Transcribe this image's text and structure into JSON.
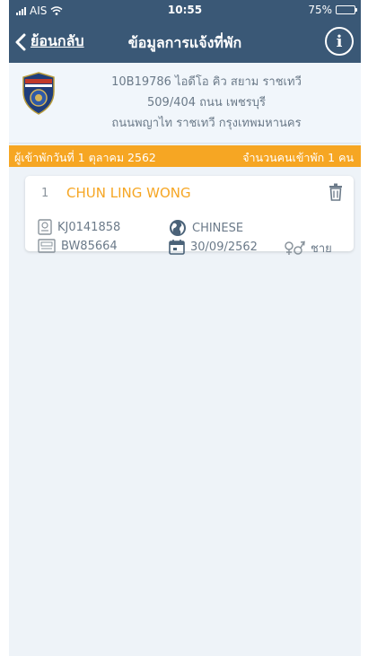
{
  "status": {
    "carrier": "AIS",
    "time": "10:55",
    "battery": "75%",
    "battery_level": 0.75
  },
  "nav": {
    "back_label": "ย้อนกลับ",
    "title": "ข้อมูลการแจ้งที่พัก",
    "info_label": "i"
  },
  "hotel": {
    "line1": "10B19786 ไอดีโอ คิว สยาม ราชเทวี",
    "line2": "509/404 ถนน เพชรบุรี",
    "line3": "ถนนพญาไท ราชเทวี กรุงเทพมหานคร"
  },
  "summary": {
    "checkin": "ผู้เข้าพักวันที่ 1 ตุลาคม 2562",
    "count": "จำนวนคนเข้าพัก 1 คน"
  },
  "guests": [
    {
      "index": "1",
      "name": "CHUN LING WONG",
      "passport": "KJ0141858",
      "nationality": "CHINESE",
      "visa": "BW85664",
      "date": "30/09/2562",
      "gender": "ชาย"
    }
  ],
  "colors": {
    "header": "#3a5876",
    "accent": "#f6a623",
    "background": "#eef3f8",
    "muted_text": "#6b7a89"
  }
}
